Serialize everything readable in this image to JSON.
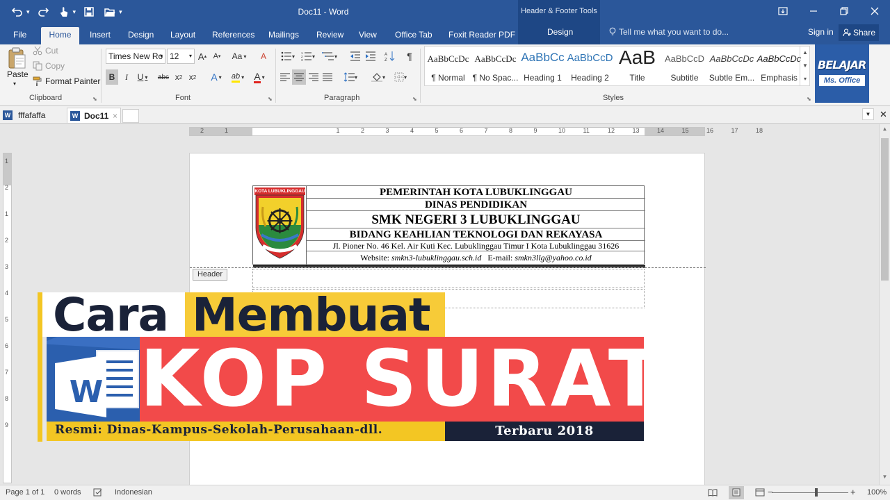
{
  "window": {
    "title": "Doc11 - Word",
    "contextual_tools": "Header & Footer Tools"
  },
  "tabs": {
    "file": "File",
    "home": "Home",
    "insert": "Insert",
    "design": "Design",
    "layout": "Layout",
    "references": "References",
    "mailings": "Mailings",
    "review": "Review",
    "view": "View",
    "office_tab": "Office Tab",
    "foxit": "Foxit Reader PDF",
    "hf_design": "Design",
    "tell_me": "Tell me what you want to do...",
    "sign_in": "Sign in",
    "share": "Share"
  },
  "clipboard": {
    "paste": "Paste",
    "cut": "Cut",
    "copy": "Copy",
    "format_painter": "Format Painter",
    "label": "Clipboard"
  },
  "font": {
    "family": "Times New Ro",
    "size": "12",
    "grow": "A",
    "shrink": "A",
    "case": "Aa",
    "clear": "A",
    "bold": "B",
    "italic": "I",
    "underline": "U",
    "strike": "abc",
    "subscript": "x",
    "superscript": "x",
    "effects": "A",
    "highlight": "ab",
    "color": "A",
    "label": "Font"
  },
  "paragraph": {
    "label": "Paragraph",
    "marks": "¶"
  },
  "styles": {
    "label": "Styles",
    "items": [
      {
        "sample": "AaBbCcDc",
        "name": "¶ Normal"
      },
      {
        "sample": "AaBbCcDc",
        "name": "¶ No Spac..."
      },
      {
        "sample": "AaBbCc",
        "name": "Heading 1"
      },
      {
        "sample": "AaBbCcD",
        "name": "Heading 2"
      },
      {
        "sample": "AaB",
        "name": "Title"
      },
      {
        "sample": "AaBbCcD",
        "name": "Subtitle"
      },
      {
        "sample": "AaBbCcDc",
        "name": "Subtle Em..."
      },
      {
        "sample": "AaBbCcDc",
        "name": "Emphasis"
      }
    ]
  },
  "promo_logo": {
    "line1": "BELAJAR",
    "line2": "Ms. Office"
  },
  "doc_tabs": {
    "tab1": "fffafaffa",
    "tab2": "Doc11",
    "close": "×"
  },
  "ruler": {
    "numbers": [
      "2",
      "1",
      "1",
      "2",
      "3",
      "4",
      "5",
      "6",
      "7",
      "8",
      "9",
      "10",
      "11",
      "12",
      "13",
      "14",
      "15",
      "16",
      "17",
      "18"
    ],
    "vnumbers": [
      "1",
      "2",
      "1",
      "2",
      "3",
      "4",
      "5",
      "6",
      "7",
      "8",
      "9"
    ]
  },
  "letterhead": {
    "logo_caption": "KOTA LUBUKLINGGAU",
    "line1": "PEMERINTAH KOTA LUBUKLINGGAU",
    "line2": "DINAS PENDIDIKAN",
    "line3": "SMK NEGERI 3 LUBUKLINGGAU",
    "line4": "BIDANG KEAHLIAN TEKNOLOGI DAN REKAYASA",
    "line5": "Jl. Pioner No. 46 Kel. Air Kuti Kec. Lubuklinggau Timur I Kota Lubuklinggau 31626",
    "website_label": "Website:",
    "website": "smkn3-lubuklinggau.sch.id",
    "email_label": "E-mail:",
    "email": "smkn3llg@yahoo.co.id"
  },
  "header_tag": "Header",
  "banner": {
    "word1": "Cara",
    "word2": "Membuat",
    "big": "KOP SURAT",
    "word_logo": "W",
    "sub_left": "Resmi: Dinas-Kampus-Sekolah-Perusahaan-dll.",
    "sub_right": "Terbaru 2018"
  },
  "status": {
    "page": "Page 1 of 1",
    "words": "0 words",
    "language": "Indonesian",
    "zoom": "100%",
    "zoom_minus": "−",
    "zoom_plus": "+"
  },
  "colors": {
    "word_blue": "#2b579a",
    "banner_yellow": "#f7cb38",
    "banner_red": "#f24a4a",
    "banner_navy": "#1a2238"
  }
}
